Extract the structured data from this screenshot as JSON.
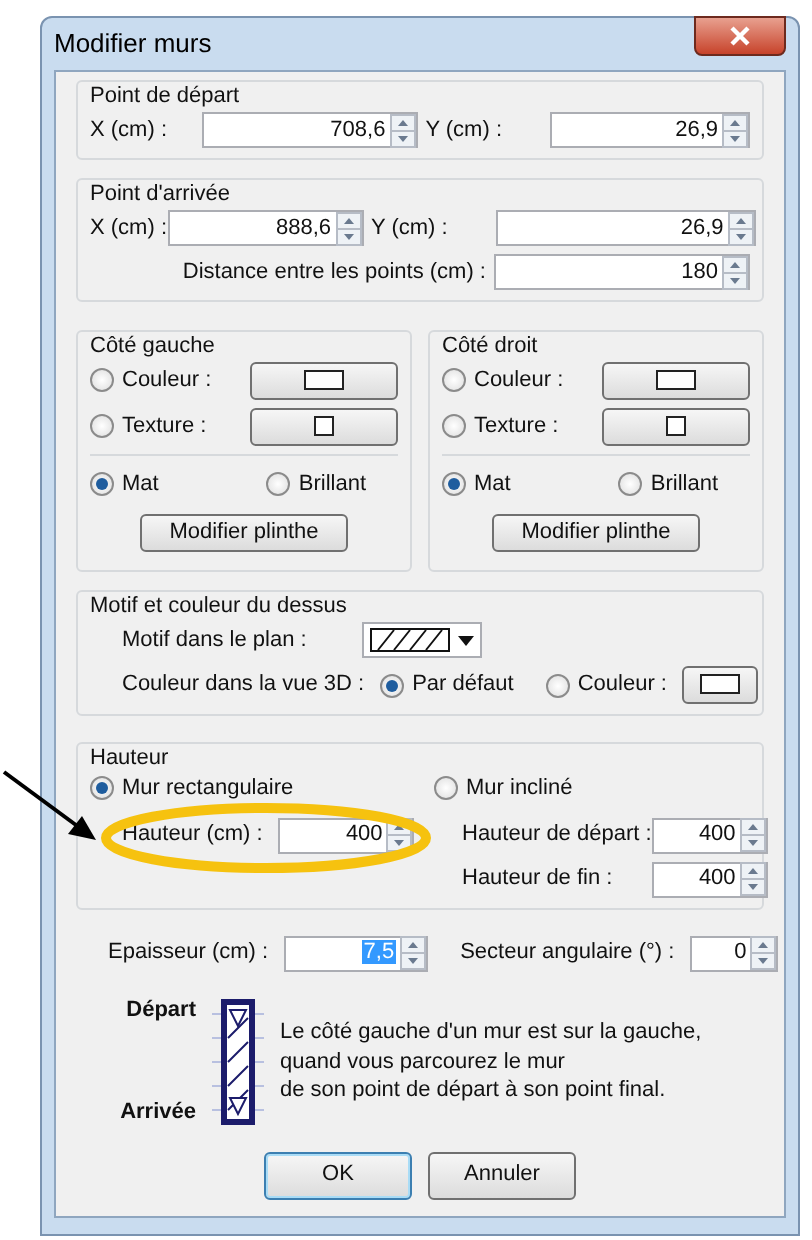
{
  "window": {
    "title": "Modifier murs"
  },
  "start_point": {
    "title": "Point de départ",
    "fields": [
      {
        "label": "X (cm) :",
        "value": "708,6"
      },
      {
        "label": "Y (cm) :",
        "value": "26,9"
      }
    ]
  },
  "end_point": {
    "title": "Point d'arrivée",
    "fields": [
      {
        "label": "X (cm) :",
        "value": "888,6"
      },
      {
        "label": "Y (cm) :",
        "value": "26,9"
      }
    ],
    "distance": {
      "label": "Distance entre les points (cm) :",
      "value": "180"
    }
  },
  "sides": [
    {
      "title": "Côté gauche",
      "options": [
        {
          "label": "Couleur :",
          "selected": false,
          "kind": "color"
        },
        {
          "label": "Texture :",
          "selected": false,
          "kind": "texture"
        }
      ],
      "finish": [
        {
          "label": "Mat",
          "selected": true
        },
        {
          "label": "Brillant",
          "selected": false
        }
      ],
      "button": "Modifier plinthe"
    },
    {
      "title": "Côté droit",
      "options": [
        {
          "label": "Couleur :",
          "selected": false,
          "kind": "color"
        },
        {
          "label": "Texture :",
          "selected": false,
          "kind": "texture"
        }
      ],
      "finish": [
        {
          "label": "Mat",
          "selected": true
        },
        {
          "label": "Brillant",
          "selected": false
        }
      ],
      "button": "Modifier plinthe"
    }
  ],
  "top": {
    "title": "Motif et couleur du dessus",
    "pattern_label": "Motif dans le plan :",
    "color_label": "Couleur dans la vue 3D :",
    "color_options": [
      {
        "label": "Par défaut",
        "selected": true
      },
      {
        "label": "Couleur :",
        "selected": false
      }
    ]
  },
  "height": {
    "title": "Hauteur",
    "modes": [
      {
        "label": "Mur rectangulaire",
        "selected": true
      },
      {
        "label": "Mur incliné",
        "selected": false
      }
    ],
    "fields": [
      {
        "label": "Hauteur (cm) :",
        "value": "400"
      },
      {
        "label": "Hauteur de départ :",
        "value": "400"
      },
      {
        "label": "Hauteur de fin :",
        "value": "400"
      }
    ]
  },
  "thickness": {
    "label": "Epaisseur (cm) :",
    "value": "7,5",
    "text_selected": true
  },
  "angle": {
    "label": "Secteur angulaire (°) :",
    "value": "0"
  },
  "legend": {
    "start": "Départ",
    "end": "Arrivée",
    "text": "Le côté gauche d'un mur est sur la gauche,\nquand vous parcourez le mur\nde son point de départ à son point final."
  },
  "buttons": [
    {
      "label": "OK",
      "default": true
    },
    {
      "label": "Annuler",
      "default": false
    }
  ],
  "annotation": {
    "arrow": true,
    "highlight_ellipse": true
  }
}
